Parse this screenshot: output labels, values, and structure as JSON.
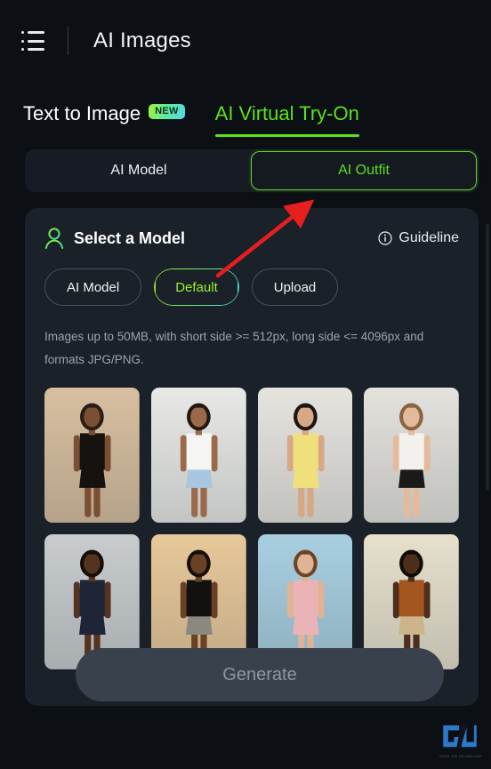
{
  "header": {
    "title": "AI Images",
    "menu_icon": "list-menu-icon"
  },
  "tabs": [
    {
      "label": "Text to Image",
      "badge": "NEW",
      "active": false
    },
    {
      "label": "AI Virtual Try-On",
      "badge": null,
      "active": true
    }
  ],
  "segments": [
    {
      "label": "AI Model",
      "active": false
    },
    {
      "label": "AI Outfit",
      "active": true
    }
  ],
  "panel": {
    "title": "Select a Model",
    "title_icon": "person-icon",
    "guideline": {
      "label": "Guideline",
      "icon": "info-circle-icon"
    },
    "sources": [
      {
        "label": "AI Model",
        "active": false
      },
      {
        "label": "Default",
        "active": true
      },
      {
        "label": "Upload",
        "active": false
      }
    ],
    "hint": "Images up to 50MB, with short side >= 512px, long side <= 4096px and formats JPG/PNG.",
    "thumbnails": [
      {
        "name": "model-thumb-1",
        "alt": "woman in black mini dress",
        "bg": "#d8bfa0",
        "skin": "#7a4f33",
        "hair": "#2b1d16",
        "garment_top": "#15120f",
        "garment_bottom": "#15120f"
      },
      {
        "name": "model-thumb-2",
        "alt": "woman in white crop top and denim shorts",
        "bg": "#e8e9e6",
        "skin": "#9a6a4a",
        "hair": "#241812",
        "garment_top": "#f5f5f3",
        "garment_bottom": "#a9c6e0"
      },
      {
        "name": "model-thumb-3",
        "alt": "woman in yellow two-piece set",
        "bg": "#e6e4df",
        "skin": "#d7a885",
        "hair": "#1d1510",
        "garment_top": "#efe07c",
        "garment_bottom": "#efe07c"
      },
      {
        "name": "model-thumb-4",
        "alt": "woman in white top and black leather skirt",
        "bg": "#e4e2dd",
        "skin": "#e3bb9c",
        "hair": "#8a6440",
        "garment_top": "#f2f1ee",
        "garment_bottom": "#1b1a18"
      },
      {
        "name": "model-thumb-5",
        "alt": "man in navy long sleeve top",
        "bg": "#c8ccce",
        "skin": "#54331f",
        "hair": "#140d08",
        "garment_top": "#1d2536",
        "garment_bottom": "#1d2536"
      },
      {
        "name": "model-thumb-6",
        "alt": "man in black sweater and grey trousers",
        "bg": "#e7c89a",
        "skin": "#6b4126",
        "hair": "#160f09",
        "garment_top": "#13110f",
        "garment_bottom": "#8b8880"
      },
      {
        "name": "model-thumb-7",
        "alt": "man in pink t-shirt",
        "bg": "#a8cfe0",
        "skin": "#e0b394",
        "hair": "#6b4526",
        "garment_top": "#eab3b6",
        "garment_bottom": "#eab3b6"
      },
      {
        "name": "model-thumb-8",
        "alt": "man in brown jacket and beige trousers",
        "bg": "#e6e0cd",
        "skin": "#4d2e1c",
        "hair": "#120c07",
        "garment_top": "#a4561f",
        "garment_bottom": "#cdb48a"
      }
    ]
  },
  "generate_button": {
    "label": "Generate",
    "disabled": true
  },
  "annotation": {
    "type": "red-arrow",
    "points_to": "AI Outfit",
    "color": "#e51e1e"
  },
  "watermark": {
    "letters": "GJ",
    "caption": "GOOD JOB TECHNOLOGY",
    "color": "#2f7fd4"
  },
  "colors": {
    "page_bg": "#0c0f14",
    "panel_bg": "#1a2128",
    "segment_bg": "#171c24",
    "accent_green": "#5ce11e",
    "accent_lime": "#9ef02e",
    "accent_cyan": "#4ed6e8",
    "muted_text": "#9aa4ad",
    "disabled_btn": "#39414d"
  }
}
